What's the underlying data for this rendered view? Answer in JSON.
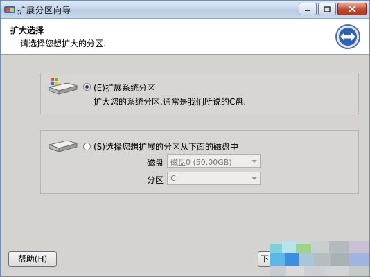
{
  "window": {
    "title": "扩展分区向导"
  },
  "header": {
    "title": "扩大选择",
    "subtitle": "请选择您想扩大的分区."
  },
  "options": [
    {
      "label": "(E)扩展系统分区",
      "description": "扩大您的系统分区,通常是我们所说的C盘.",
      "checked": true
    },
    {
      "label": "(S)选择您想扩展的分区从下面的磁盘中",
      "checked": false,
      "disk_label": "磁盘",
      "disk_value": "磁盘0 (50.00GB)",
      "partition_label": "分区",
      "partition_value": "C:"
    }
  ],
  "footer": {
    "help_label": "帮助(H)",
    "next_label": "下"
  }
}
